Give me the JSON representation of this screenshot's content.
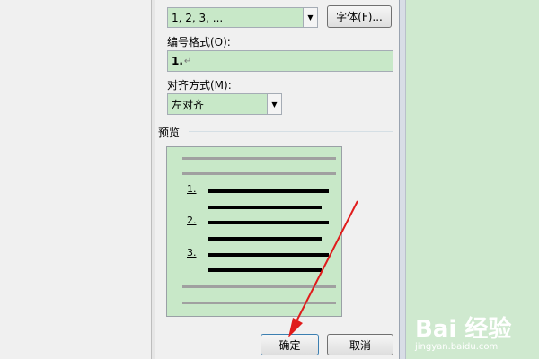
{
  "number_style": {
    "value": "1, 2, 3, ...",
    "font_button": "字体(F)..."
  },
  "number_format": {
    "label": "编号格式(O):",
    "value": "1.",
    "paragraph_mark": "↵"
  },
  "alignment": {
    "label": "对齐方式(M):",
    "value": "左对齐"
  },
  "preview": {
    "label": "预览",
    "numbers": [
      "1.",
      "2.",
      "3."
    ]
  },
  "buttons": {
    "ok": "确定",
    "cancel": "取消"
  },
  "watermark": {
    "logo": "Bai 经验",
    "url": "jingyan.baidu.com"
  },
  "colors": {
    "field_bg": "#c8e8c8",
    "page_bg": "#cfe9cf",
    "arrow": "#e01b1b"
  }
}
